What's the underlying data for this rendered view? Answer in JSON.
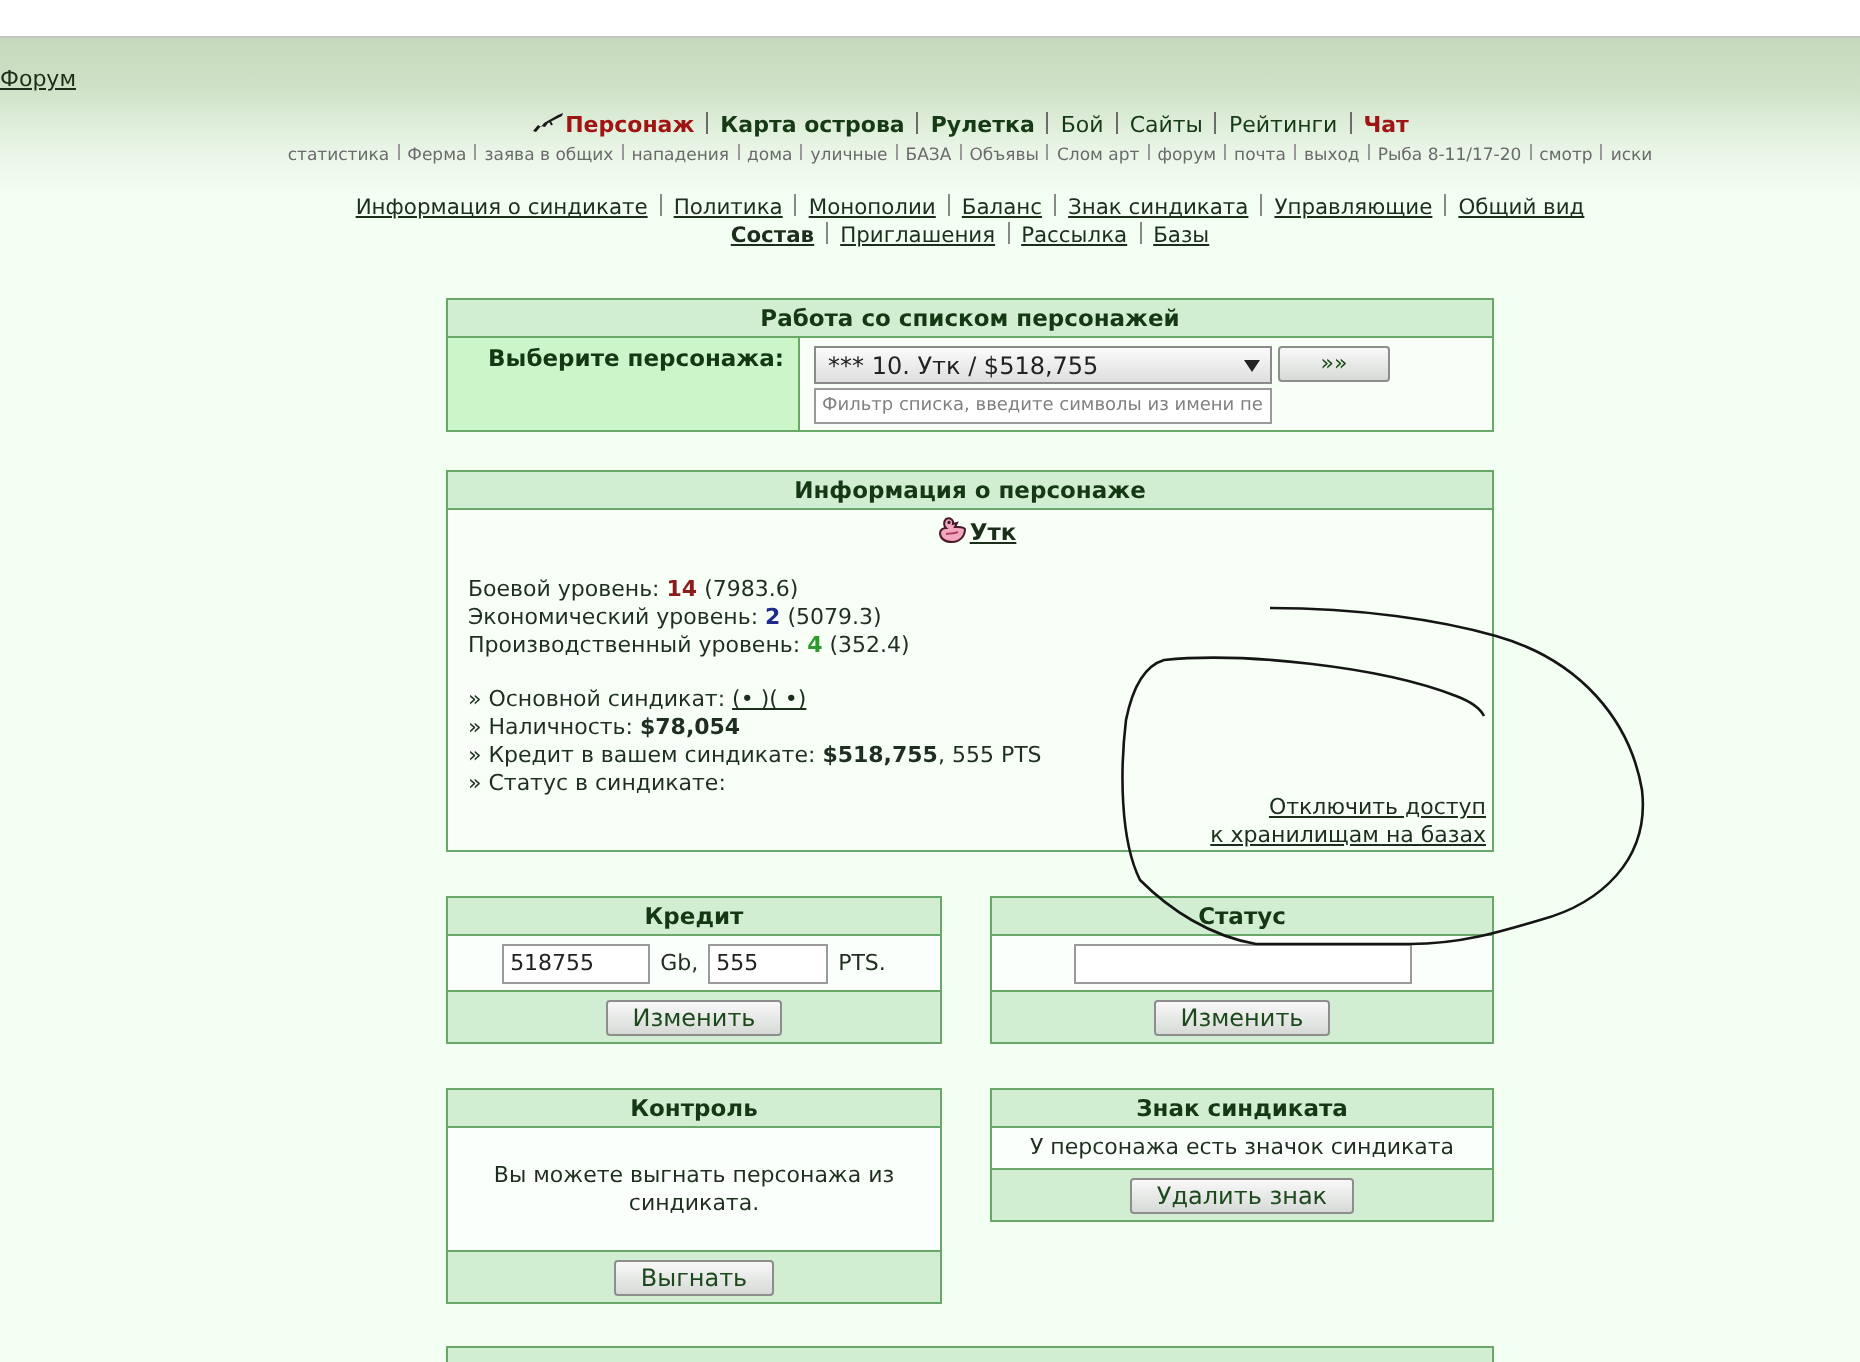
{
  "top_link": {
    "label": "Форум"
  },
  "main_nav": [
    {
      "label": "Персонаж",
      "bold": true,
      "color": "#a01414"
    },
    {
      "label": "Карта острова",
      "bold": true,
      "color": "#163a16"
    },
    {
      "label": "Рулетка",
      "bold": true,
      "color": "#163a16"
    },
    {
      "label": "Бой",
      "bold": false,
      "color": "#163a16"
    },
    {
      "label": "Сайты",
      "bold": false,
      "color": "#163a16"
    },
    {
      "label": "Рейтинги",
      "bold": false,
      "color": "#163a16"
    },
    {
      "label": "Чат",
      "bold": true,
      "color": "#a01414"
    }
  ],
  "sub_nav": [
    "статистика",
    "Ферма",
    "заява в общих",
    "нападения",
    "дома",
    "уличные",
    "БАЗА",
    "Объявы",
    "Слом арт",
    "форум",
    "почта",
    "выход",
    "Рыба 8-11/17-20",
    "смотр",
    "иски"
  ],
  "syndicate_nav": [
    [
      {
        "label": "Информация о синдикате",
        "selected": false
      },
      {
        "label": "Политика",
        "selected": false
      },
      {
        "label": "Монополии",
        "selected": false
      },
      {
        "label": "Баланс",
        "selected": false
      },
      {
        "label": "Знак синдиката",
        "selected": false
      },
      {
        "label": "Управляющие",
        "selected": false
      },
      {
        "label": "Общий вид",
        "selected": false
      }
    ],
    [
      {
        "label": "Состав",
        "selected": true
      },
      {
        "label": "Приглашения",
        "selected": false
      },
      {
        "label": "Рассылка",
        "selected": false
      },
      {
        "label": "Базы",
        "selected": false
      }
    ]
  ],
  "character_list_panel": {
    "title": "Работа со списком персонажей",
    "select_label": "Выберите персонажа:",
    "select_value": "*** 10. Утк / $518,755",
    "go_button": "»»",
    "filter": {
      "placeholder": "Фильтр списка, введите символы из имени пе"
    }
  },
  "info_panel": {
    "title": "Информация о персонаже",
    "character_name": "Утк",
    "levels": [
      {
        "label": "Боевой уровень:",
        "value": "14",
        "color": "#8c1c1c",
        "points": "(7983.6)"
      },
      {
        "label": "Экономический уровень:",
        "value": "2",
        "color": "#1c2a8c",
        "points": "(5079.3)"
      },
      {
        "label": "Производственный уровень:",
        "value": "4",
        "color": "#2e9a2e",
        "points": "(352.4)"
      }
    ],
    "details": [
      {
        "kind": "link",
        "label": "» Основной синдикат:",
        "link": "(• )( •)"
      },
      {
        "kind": "text",
        "text": "» Наличность: **$78,054**"
      },
      {
        "kind": "text",
        "text": "» Кредит в вашем синдикате: **$518,755**, 555 PTS"
      },
      {
        "kind": "text",
        "text": "» Статус в синдикате:"
      }
    ],
    "access_link": [
      "Отключить доступ",
      "к хранилищам на базах"
    ]
  },
  "credit_panel": {
    "title": "Кредит",
    "money": "518755",
    "money_unit": "Gb,",
    "points": "555",
    "points_unit": "PTS.",
    "button": "Изменить"
  },
  "status_panel": {
    "title": "Статус",
    "button": "Изменить"
  },
  "control_panel": {
    "title": "Контроль",
    "message": "Вы можете выгнать персонажа из синдиката.",
    "button": "Выгнать"
  },
  "sign_panel": {
    "title": "Знак синдиката",
    "message": "У персонажа есть значок синдиката",
    "button": "Удалить знак"
  }
}
